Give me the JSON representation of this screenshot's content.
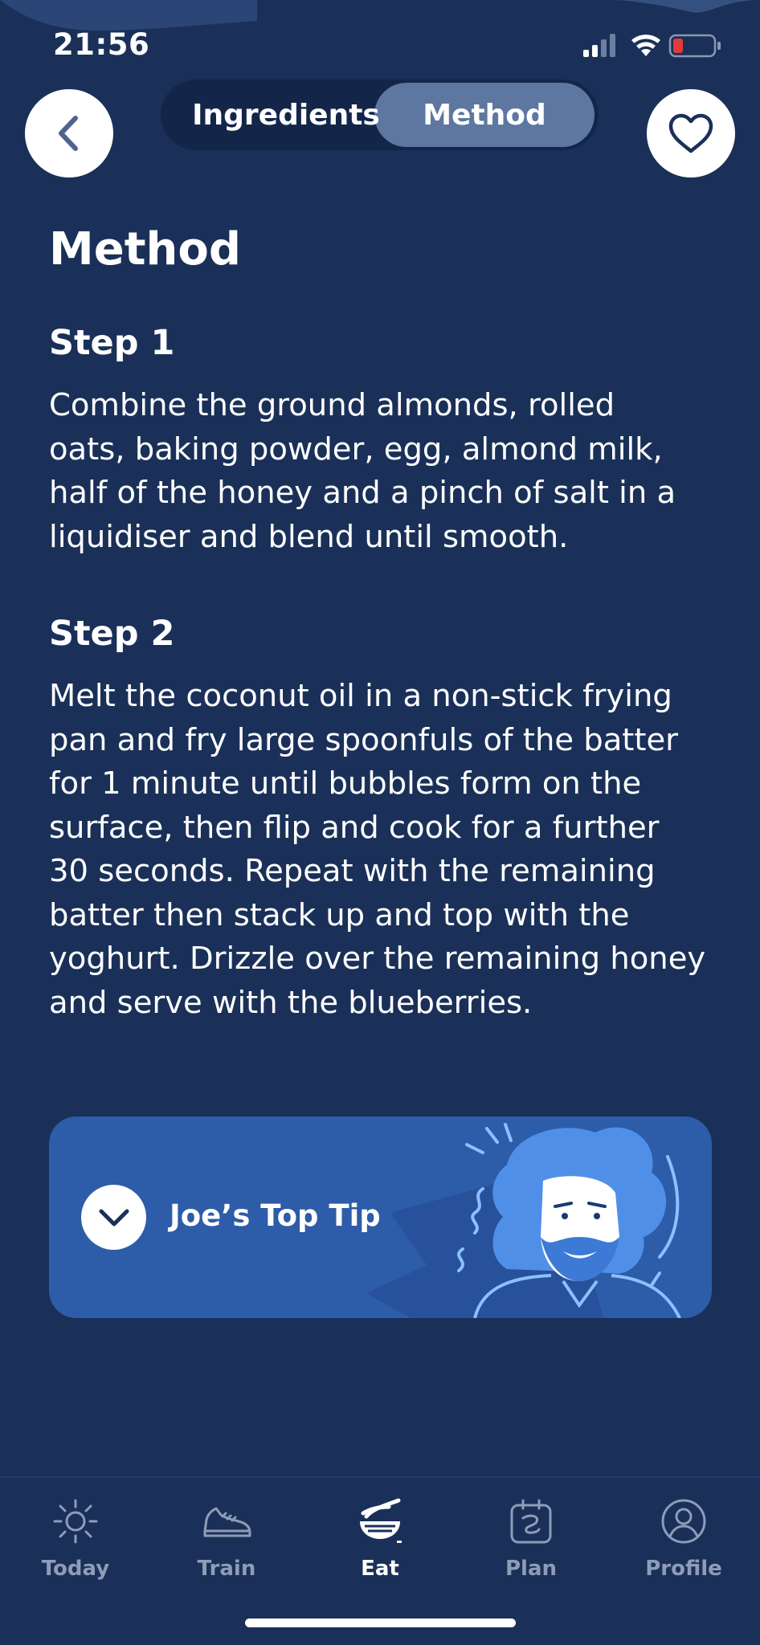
{
  "status_bar": {
    "time": "21:56",
    "icons": [
      "signal-icon",
      "wifi-icon",
      "battery-icon"
    ],
    "battery_color": "#e23a3a"
  },
  "header": {
    "back_icon": "chevron-left-icon",
    "favorite_icon": "heart-icon",
    "tabs": [
      {
        "label": "Ingredients",
        "selected": false
      },
      {
        "label": "Method",
        "selected": true
      }
    ]
  },
  "content": {
    "title": "Method",
    "steps": [
      {
        "heading": "Step 1",
        "lines": [
          "Combine the ground almonds, rolled",
          "oats, baking powder, egg, almond milk,",
          "half of the honey and a pinch of salt in a",
          "liquidiser and blend until smooth."
        ]
      },
      {
        "heading": "Step 2",
        "lines": [
          "Melt the coconut oil in a non-stick frying",
          "pan and fry large spoonfuls of the batter",
          "for 1 minute until bubbles form on the",
          "surface, then flip and cook for a further",
          "30 seconds. Repeat with the remaining",
          "batter then stack up and top with the",
          "yoghurt. Drizzle over the remaining honey",
          "and serve with the blueberries."
        ]
      }
    ]
  },
  "tip": {
    "label": "Joe’s Top Tip",
    "toggle_icon": "chevron-down-icon",
    "illustration": "joe-avatar-illustration"
  },
  "tab_bar": {
    "items": [
      {
        "label": "Today",
        "icon": "sun-icon",
        "active": false
      },
      {
        "label": "Train",
        "icon": "sneaker-icon",
        "active": false
      },
      {
        "label": "Eat",
        "icon": "bowl-icon",
        "active": true
      },
      {
        "label": "Plan",
        "icon": "calendar-icon",
        "active": false
      },
      {
        "label": "Profile",
        "icon": "user-icon",
        "active": false
      }
    ]
  },
  "colors": {
    "background": "#1a3058",
    "segment_bg": "#13264a",
    "segment_selected": "#5e77a1",
    "tip_card": "#2d5ca8",
    "inactive_tab": "#8e9cb8"
  }
}
